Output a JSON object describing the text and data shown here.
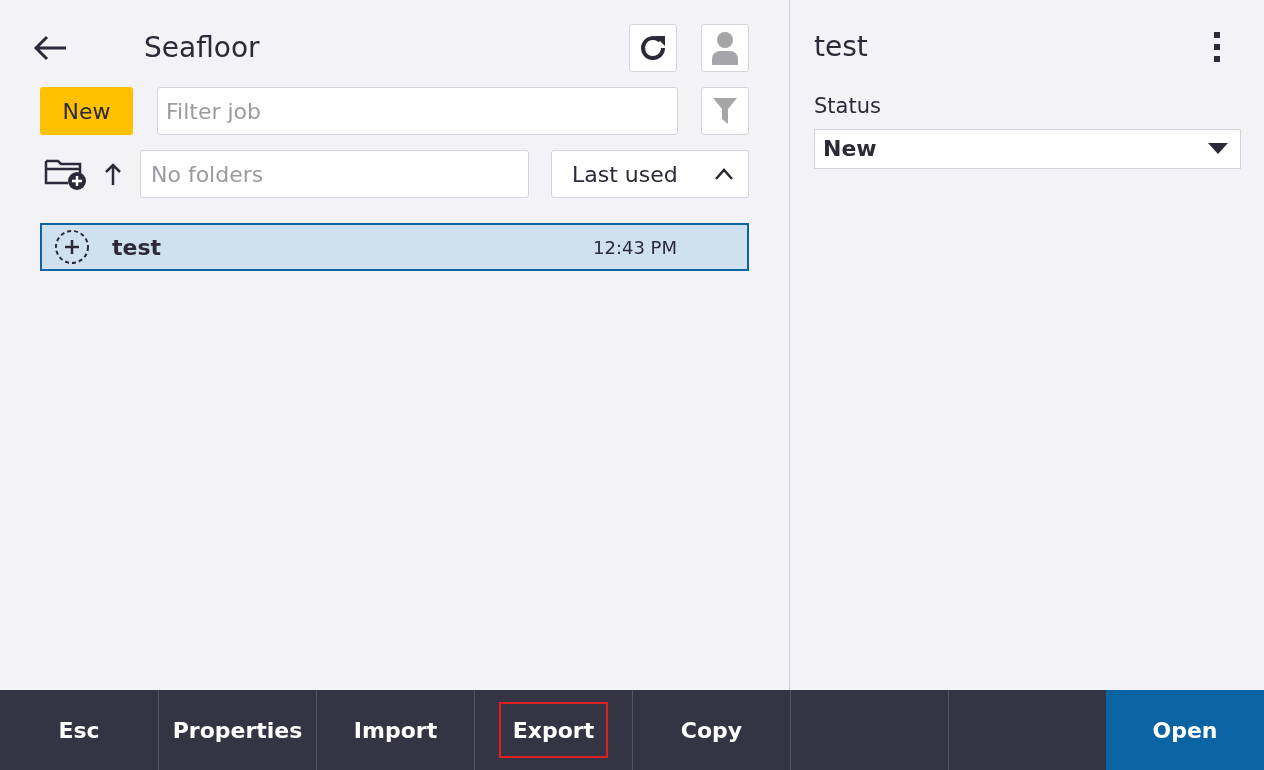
{
  "header": {
    "title": "Seafloor"
  },
  "new_button": {
    "label": "New"
  },
  "filter": {
    "placeholder": "Filter job"
  },
  "folder": {
    "placeholder": "No folders"
  },
  "sort": {
    "label": "Last used",
    "ascending": true
  },
  "jobs": [
    {
      "name": "test",
      "time": "12:43 PM",
      "selected": true
    }
  ],
  "details": {
    "title": "test",
    "status_label": "Status",
    "status_value": "New"
  },
  "footer_buttons": [
    {
      "kind": "plain",
      "label": "Esc",
      "highlighted": false
    },
    {
      "kind": "plain",
      "label": "Properties",
      "highlighted": false
    },
    {
      "kind": "plain",
      "label": "Import",
      "highlighted": false
    },
    {
      "kind": "plain",
      "label": "Export",
      "highlighted": true
    },
    {
      "kind": "plain",
      "label": "Copy",
      "highlighted": false
    },
    {
      "kind": "empty"
    },
    {
      "kind": "empty"
    },
    {
      "kind": "primary",
      "label": "Open",
      "highlighted": false
    }
  ]
}
